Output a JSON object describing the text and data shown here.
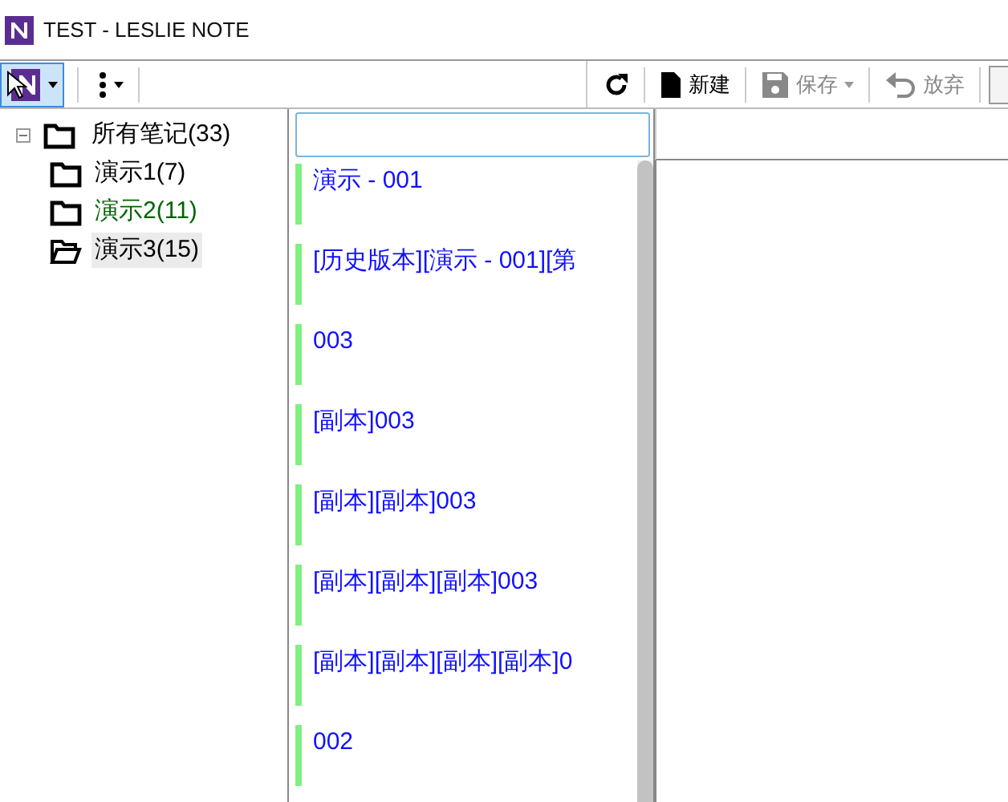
{
  "window": {
    "title": "TEST - LESLIE NOTE"
  },
  "toolbar": {
    "items": [
      {
        "kind": "app",
        "selected": true,
        "disabled": false
      },
      {
        "kind": "more",
        "selected": false,
        "disabled": false
      },
      {
        "kind": "refresh",
        "selected": false,
        "disabled": false
      },
      {
        "kind": "new",
        "label": "新建",
        "selected": false,
        "disabled": false
      },
      {
        "kind": "save",
        "label": "保存",
        "selected": false,
        "disabled": true
      },
      {
        "kind": "discard",
        "label": "放弃",
        "selected": false,
        "disabled": true
      }
    ]
  },
  "tree": {
    "label": "所有笔记(33)",
    "expanded": true,
    "children": [
      {
        "label": "演示1(7)",
        "selected": false,
        "color": "#000000"
      },
      {
        "label": "演示2(11)",
        "selected": false,
        "color": "#006400"
      },
      {
        "label": "演示3(15)",
        "selected": true,
        "color": "#000000"
      }
    ]
  },
  "notes": [
    {
      "title": "演示 - 001"
    },
    {
      "title": "[历史版本][演示 - 001][第"
    },
    {
      "title": "003"
    },
    {
      "title": "[副本]003"
    },
    {
      "title": "[副本][副本]003"
    },
    {
      "title": "[副本][副本][副本]003"
    },
    {
      "title": "[副本][副本][副本][副本]0"
    },
    {
      "title": "002"
    }
  ]
}
